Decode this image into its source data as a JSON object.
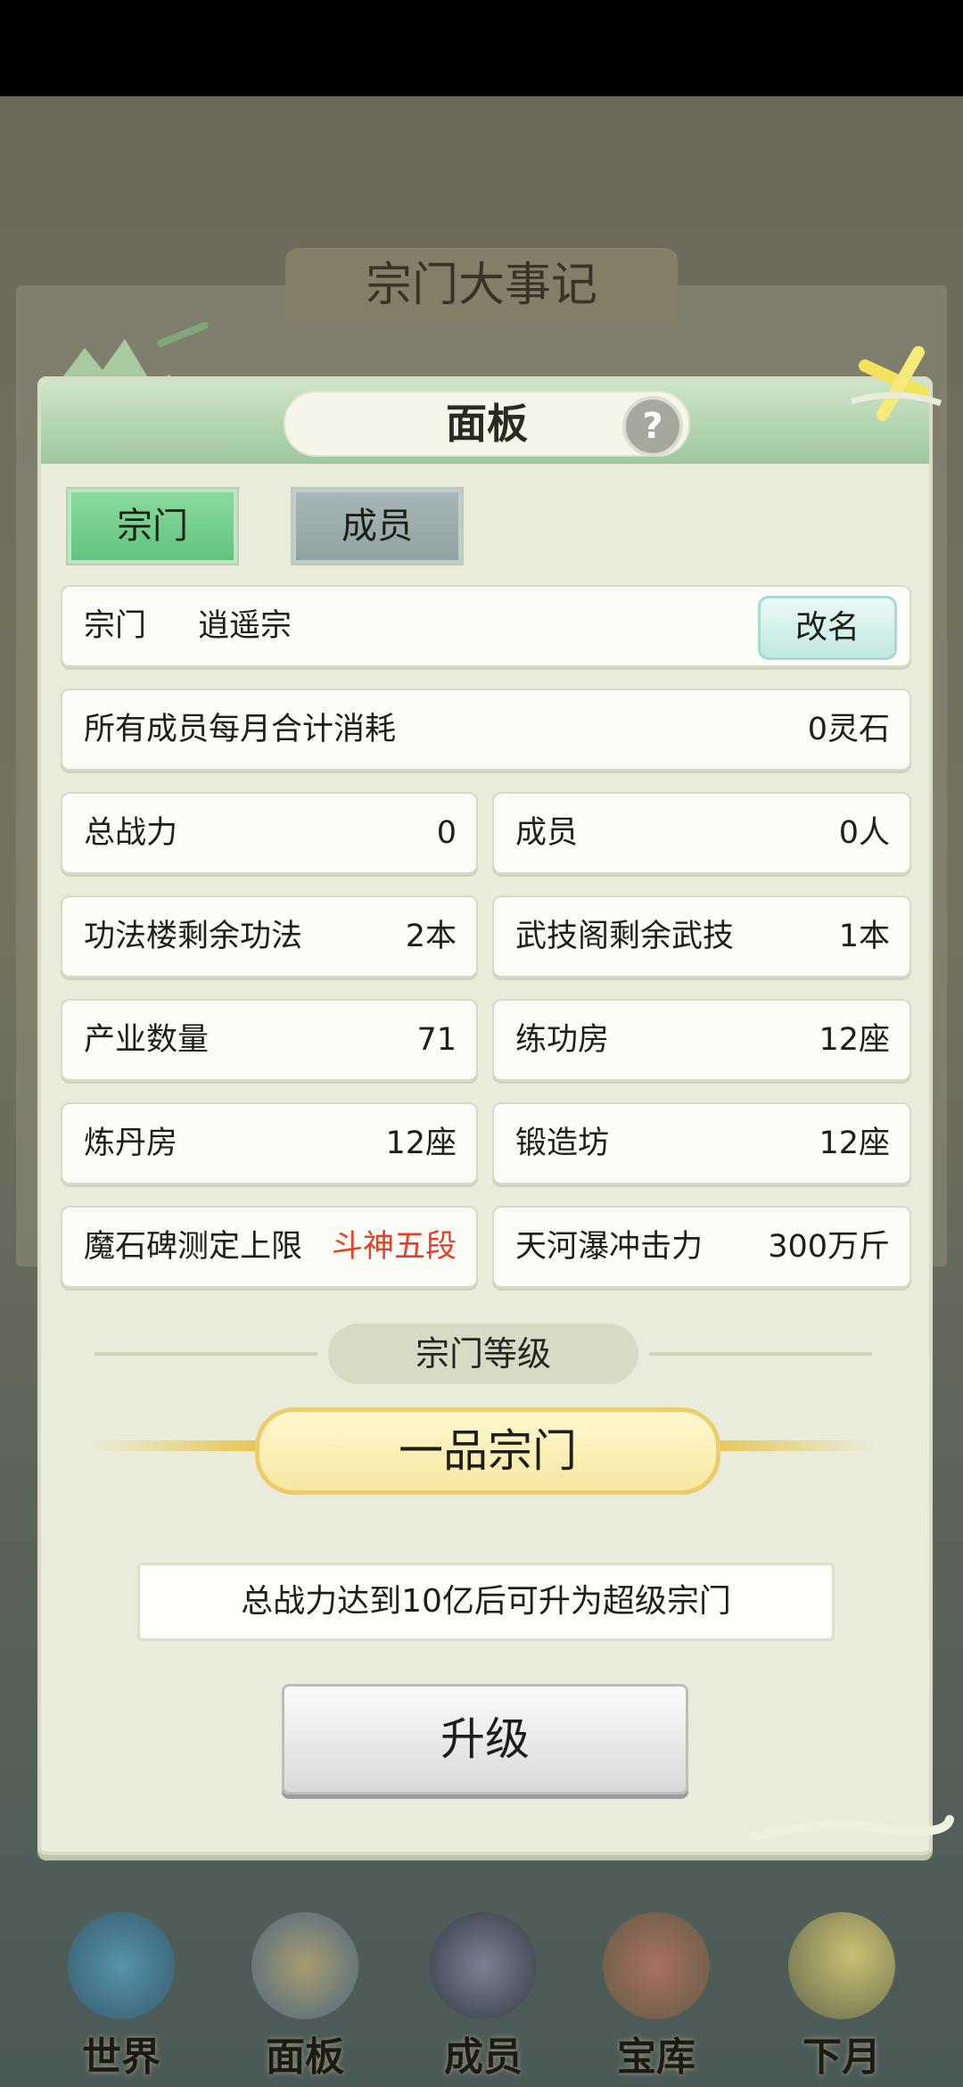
{
  "background": {
    "event_banner": "宗门大事记"
  },
  "panel": {
    "title": "面板",
    "help_glyph": "?",
    "tabs": [
      {
        "label": "宗门",
        "active": true
      },
      {
        "label": "成员",
        "active": false
      }
    ]
  },
  "sect": {
    "label": "宗门",
    "name": "逍遥宗",
    "rename_label": "改名"
  },
  "monthly_cost": {
    "label": "所有成员每月合计消耗",
    "value": "0灵石"
  },
  "stats": [
    {
      "label": "总战力",
      "value": "0"
    },
    {
      "label": "成员",
      "value": "0人"
    },
    {
      "label": "功法楼剩余功法",
      "value": "2本"
    },
    {
      "label": "武技阁剩余武技",
      "value": "1本"
    },
    {
      "label": "产业数量",
      "value": "71"
    },
    {
      "label": "练功房",
      "value": "12座"
    },
    {
      "label": "炼丹房",
      "value": "12座"
    },
    {
      "label": "锻造坊",
      "value": "12座"
    },
    {
      "label": "魔石碑测定上限",
      "value": "斗神五段",
      "value_color": "#e2412a"
    },
    {
      "label": "天河瀑冲击力",
      "value": "300万斤"
    }
  ],
  "level": {
    "section_label": "宗门等级",
    "current": "一品宗门",
    "note": "总战力达到10亿后可升为超级宗门",
    "upgrade_label": "升级"
  },
  "bottom_nav": [
    {
      "label": "世界",
      "icon": "world-icon"
    },
    {
      "label": "面板",
      "icon": "panel-icon"
    },
    {
      "label": "成员",
      "icon": "member-icon"
    },
    {
      "label": "宝库",
      "icon": "treasury-icon"
    },
    {
      "label": "下月",
      "icon": "next-month-icon"
    }
  ]
}
